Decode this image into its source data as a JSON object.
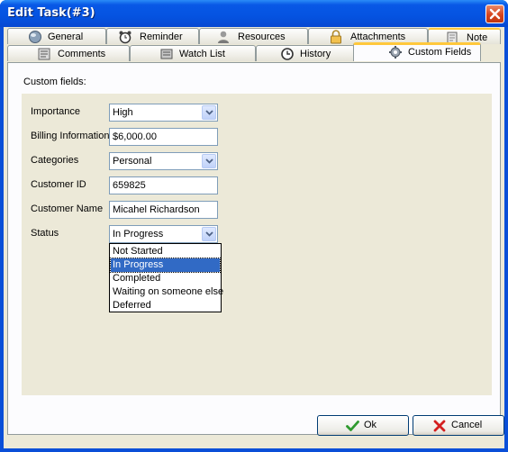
{
  "window": {
    "title": "Edit Task(#3)"
  },
  "tabs_row1": [
    {
      "label": "General",
      "icon": "globe-icon"
    },
    {
      "label": "Reminder",
      "icon": "alarm-clock-icon"
    },
    {
      "label": "Resources",
      "icon": "user-icon"
    },
    {
      "label": "Attachments",
      "icon": "lock-icon"
    },
    {
      "label": "Note",
      "icon": "note-icon"
    }
  ],
  "tabs_row2": [
    {
      "label": "Comments",
      "icon": "comments-icon"
    },
    {
      "label": "Watch List",
      "icon": "watch-list-icon"
    },
    {
      "label": "History",
      "icon": "history-icon"
    },
    {
      "label": "Custom Fields",
      "icon": "gear-icon",
      "active": true
    }
  ],
  "pane": {
    "section_label": "Custom fields:",
    "fields": {
      "importance": {
        "label": "Importance",
        "value": "High"
      },
      "billing": {
        "label": "Billing Information",
        "value": "$6,000.00"
      },
      "categories": {
        "label": "Categories",
        "value": "Personal"
      },
      "customer_id": {
        "label": "Customer ID",
        "value": "659825"
      },
      "customer_name": {
        "label": "Customer Name",
        "value": "Micahel Richardson"
      },
      "status": {
        "label": "Status",
        "value": "In Progress",
        "options": [
          "Not Started",
          "In Progress",
          "Completed",
          "Waiting on someone else",
          "Deferred"
        ],
        "selected_index": 1
      }
    }
  },
  "buttons": {
    "ok": "Ok",
    "cancel": "Cancel"
  },
  "colors": {
    "title_bar": "#0553e1",
    "active_tab_accent": "#ffc83c",
    "selection": "#316ac5",
    "dialog_bg": "#ece9d8"
  }
}
